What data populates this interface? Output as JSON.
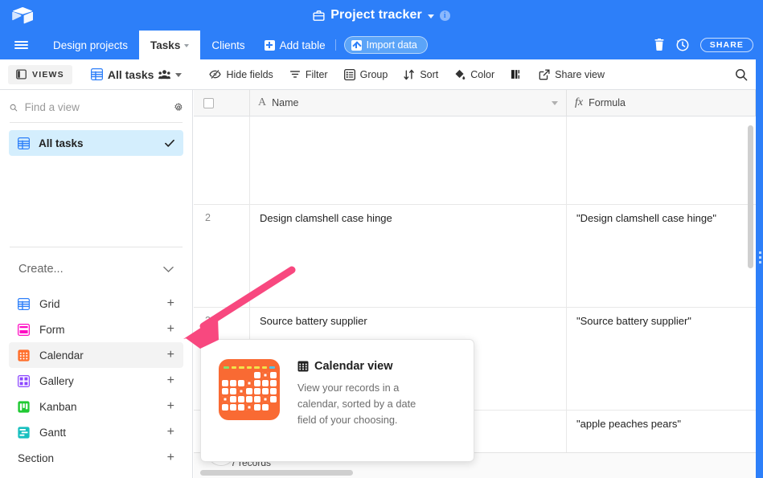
{
  "topbar": {
    "logo_icon": "airtable-cube-logo",
    "base_title": "Project tracker",
    "base_icon": "briefcase-icon",
    "caret_icon": "chevron-down-icon",
    "info_icon": "info-icon",
    "info_glyph": "i",
    "background_color": "#2d7ff9"
  },
  "tabbar": {
    "menu_icon": "hamburger-menu-icon",
    "tabs": [
      {
        "label": "Design projects",
        "active": false
      },
      {
        "label": "Tasks",
        "active": true
      },
      {
        "label": "Clients",
        "active": false
      }
    ],
    "add_table_label": "Add table",
    "add_table_icon": "plus-square-icon",
    "import_data_label": "Import data",
    "import_data_icon": "upload-icon",
    "trash_icon": "trash-icon",
    "history_icon": "history-clock-icon",
    "share_label": "SHARE"
  },
  "toolbar": {
    "views_label": "VIEWS",
    "views_icon": "sidebar-panel-icon",
    "view_name": "All tasks",
    "view_icon": "grid-view-icon",
    "collaborators_icon": "people-icon",
    "view_caret_icon": "chevron-down-icon",
    "items": [
      {
        "label": "Hide fields",
        "icon": "eye-slash-icon"
      },
      {
        "label": "Filter",
        "icon": "filter-icon"
      },
      {
        "label": "Group",
        "icon": "group-icon"
      },
      {
        "label": "Sort",
        "icon": "sort-icon"
      },
      {
        "label": "Color",
        "icon": "paint-drop-icon"
      },
      {
        "label": "",
        "icon": "row-height-icon"
      },
      {
        "label": "Share view",
        "icon": "share-external-icon"
      }
    ],
    "search_icon": "search-icon"
  },
  "sidebar": {
    "search_placeholder": "Find a view",
    "search_value": "",
    "search_icon": "search-icon",
    "settings_icon": "gear-icon",
    "views": [
      {
        "label": "All tasks",
        "icon": "grid-view-icon",
        "color": "#2d7ff9",
        "selected": true,
        "check_icon": "check-icon"
      }
    ],
    "create_label": "Create...",
    "create_caret_icon": "chevron-down-icon",
    "create_items": [
      {
        "label": "Grid",
        "icon": "grid-view-icon",
        "color": "#2d7ff9",
        "add_icon": "plus-icon",
        "hovered": false
      },
      {
        "label": "Form",
        "icon": "form-view-icon",
        "color": "#ff08c2",
        "add_icon": "plus-icon",
        "hovered": false
      },
      {
        "label": "Calendar",
        "icon": "calendar-view-icon",
        "color": "#ff6f2c",
        "add_icon": "plus-icon",
        "hovered": true
      },
      {
        "label": "Gallery",
        "icon": "gallery-view-icon",
        "color": "#8b46ff",
        "add_icon": "plus-icon",
        "hovered": false
      },
      {
        "label": "Kanban",
        "icon": "kanban-view-icon",
        "color": "#20c933",
        "add_icon": "plus-icon",
        "hovered": false
      },
      {
        "label": "Gantt",
        "icon": "gantt-view-icon",
        "color": "#18bfbf",
        "add_icon": "plus-icon",
        "hovered": false
      }
    ],
    "section_label": "Section",
    "section_add_icon": "plus-icon"
  },
  "grid": {
    "select_all_icon": "checkbox-icon",
    "columns": [
      {
        "label": "Name",
        "icon": "text-field-icon",
        "icon_glyph": "A"
      },
      {
        "label": "Formula",
        "icon": "formula-field-icon",
        "icon_glyph": "fx"
      }
    ],
    "rows": [
      {
        "num": "",
        "name": "",
        "formula": ""
      },
      {
        "num": "2",
        "name": "Design clamshell case hinge",
        "formula": "\"Design clamshell case hinge\""
      },
      {
        "num": "3",
        "name": "Source battery supplier",
        "formula": "\"Source battery supplier\""
      },
      {
        "num": "",
        "name": "",
        "formula": "\"apple peaches pears\""
      }
    ],
    "record_count_label": "7 records",
    "expand_icon": "expand-row-icon"
  },
  "popup": {
    "illustration_icon": "calendar-illustration",
    "title": "Calendar view",
    "title_icon": "calendar-grid-icon",
    "description": "View your records in a calendar, sorted by a date field of your choosing."
  },
  "annotation": {
    "arrow_icon": "pink-pointer-arrow",
    "arrow_color": "#f8487f"
  }
}
